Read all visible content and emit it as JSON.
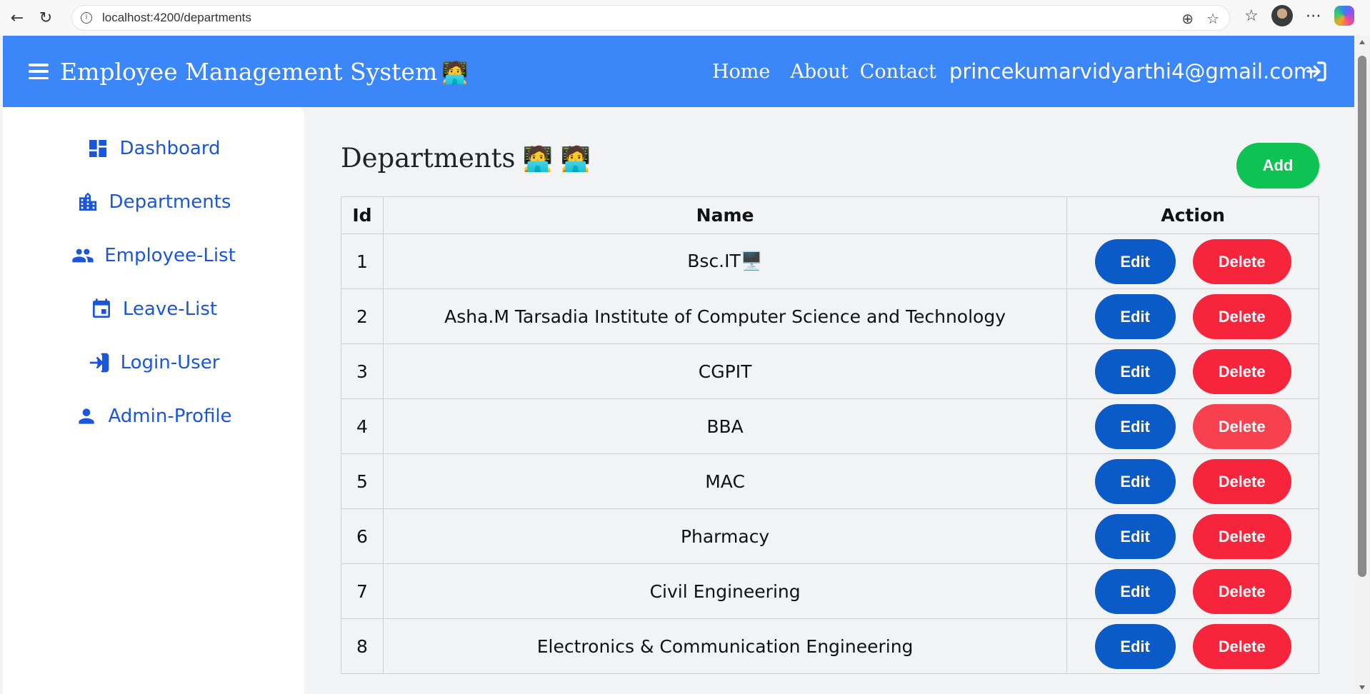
{
  "browser": {
    "url": "localhost:4200/departments"
  },
  "navbar": {
    "brand": "Employee Management System",
    "brand_emoji": "🧑‍💻",
    "links": [
      "Home",
      "About",
      "Contact"
    ],
    "email": "princekumarvidyarthi4@gmail.com"
  },
  "sidebar": {
    "items": [
      {
        "label": "Dashboard",
        "icon": "dashboard-icon"
      },
      {
        "label": "Departments",
        "icon": "building-icon"
      },
      {
        "label": "Employee-List",
        "icon": "people-icon"
      },
      {
        "label": "Leave-List",
        "icon": "calendar-icon"
      },
      {
        "label": "Login-User",
        "icon": "login-icon"
      },
      {
        "label": "Admin-Profile",
        "icon": "person-icon"
      }
    ]
  },
  "main": {
    "title": "Departments",
    "title_emoji": "🧑‍💻 🧑‍💻",
    "add_label": "Add",
    "table": {
      "headers": [
        "Id",
        "Name",
        "Action"
      ],
      "edit_label": "Edit",
      "delete_label": "Delete",
      "rows": [
        {
          "id": "1",
          "name": "Bsc.IT🖥️"
        },
        {
          "id": "2",
          "name": "Asha.M Tarsadia Institute of Computer Science and Technology"
        },
        {
          "id": "3",
          "name": "CGPIT"
        },
        {
          "id": "4",
          "name": "BBA"
        },
        {
          "id": "5",
          "name": "MAC"
        },
        {
          "id": "6",
          "name": "Pharmacy"
        },
        {
          "id": "7",
          "name": "Civil Engineering"
        },
        {
          "id": "8",
          "name": "Electronics & Communication Engineering"
        }
      ]
    }
  },
  "colors": {
    "navbar": "#3b86f8",
    "sidebar_text": "#1a56db",
    "add": "#0ec253",
    "edit": "#0a5bc7",
    "delete": "#f7253b"
  }
}
